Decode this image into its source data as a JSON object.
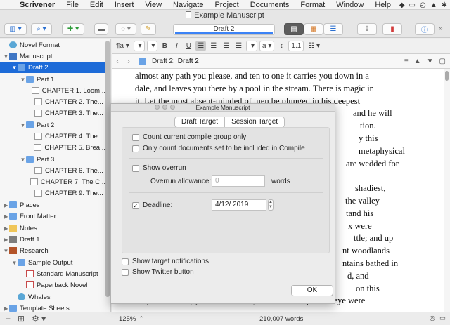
{
  "menubar": {
    "app_name": "Scrivener",
    "items": [
      "File",
      "Edit",
      "Insert",
      "View",
      "Navigate",
      "Project",
      "Documents",
      "Format",
      "Window",
      "Help"
    ]
  },
  "window": {
    "title": "Example Manuscript"
  },
  "toolbar": {
    "document_title": "Draft 2"
  },
  "binder": {
    "items": [
      {
        "label": "Novel Format",
        "icon": "globe-icon"
      },
      {
        "label": "Manuscript",
        "icon": "book-icon"
      },
      {
        "label": "Draft 2",
        "icon": "folder-icon"
      },
      {
        "label": "Part 1",
        "icon": "folder-icon"
      },
      {
        "label": "CHAPTER 1. Loom...",
        "icon": "document-icon"
      },
      {
        "label": "CHAPTER 2. The...",
        "icon": "document-icon"
      },
      {
        "label": "CHAPTER 3. The...",
        "icon": "document-icon"
      },
      {
        "label": "Part 2",
        "icon": "folder-icon"
      },
      {
        "label": "CHAPTER 4. The...",
        "icon": "document-icon"
      },
      {
        "label": "CHAPTER 5. Brea...",
        "icon": "document-icon"
      },
      {
        "label": "Part 3",
        "icon": "folder-icon"
      },
      {
        "label": "CHAPTER 6. The...",
        "icon": "document-icon"
      },
      {
        "label": "CHAPTER 7. The C...",
        "icon": "document-icon"
      },
      {
        "label": "CHAPTER 9. The...",
        "icon": "document-icon"
      },
      {
        "label": "Places",
        "icon": "folder-icon"
      },
      {
        "label": "Front Matter",
        "icon": "folder-icon"
      },
      {
        "label": "Notes",
        "icon": "notes-icon"
      },
      {
        "label": "Draft 1",
        "icon": "draft-icon"
      },
      {
        "label": "Research",
        "icon": "research-icon"
      },
      {
        "label": "Sample Output",
        "icon": "folder-icon"
      },
      {
        "label": "Standard Manuscript",
        "icon": "document-icon"
      },
      {
        "label": "Paperback Novel",
        "icon": "document-icon"
      },
      {
        "label": "Whales",
        "icon": "globe-icon"
      },
      {
        "label": "Template Sheets",
        "icon": "folder-icon"
      }
    ]
  },
  "formatbar": {
    "bold": "B",
    "italic": "I",
    "underline": "U",
    "line_spacing": "1.1"
  },
  "header": {
    "breadcrumb_parent": "Draft 2:",
    "breadcrumb_current": "Draft 2"
  },
  "editor": {
    "lines": [
      "almost any path you please, and ten to one it carries you down in a",
      "dale, and leaves you there by a pool in the stream. There is magic in",
      "it. Let the most absent-minded of men be plunged in his deepest",
      "and he will",
      "tion.",
      "y this",
      "metaphysical",
      "are wedded for",
      "",
      "shadiest,",
      "the valley",
      "tand his",
      "x were",
      "ttle; and up",
      "nt woodlands",
      "ntains bathed in",
      "d, and",
      "on this",
      "shepherd's head, yet all were vain, unless the shepherd's eye were"
    ]
  },
  "statusbar": {
    "zoom": "125%",
    "word_count": "210,007 words"
  },
  "dialog": {
    "title": "Example Manuscript",
    "tabs": [
      "Draft Target",
      "Session Target"
    ],
    "options": {
      "count_compile_group": "Count current compile group only",
      "count_included_only": "Only count documents set to be included in Compile",
      "show_overrun": "Show overrun",
      "overrun_allowance_label": "Overrun allowance:",
      "overrun_placeholder": "0",
      "overrun_unit": "words",
      "deadline_label": "Deadline:",
      "deadline_value": "4/12/ 2019",
      "show_notifications": "Show target notifications",
      "show_twitter": "Show Twitter button"
    },
    "ok_label": "OK"
  }
}
